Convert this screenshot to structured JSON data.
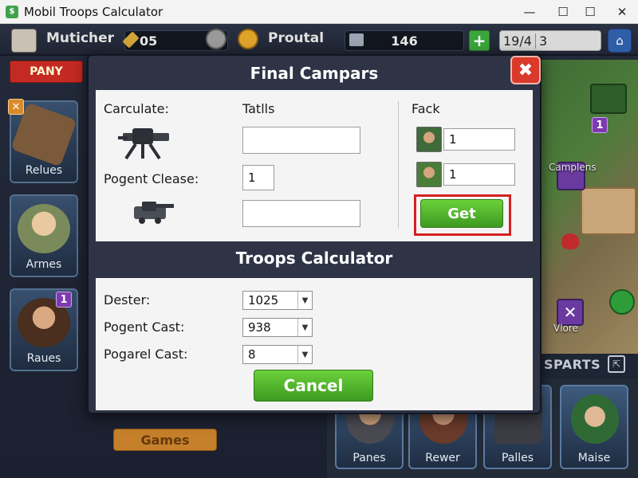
{
  "window": {
    "title": "Mobil Troops Calculator",
    "minimize": "—",
    "maximize": "☐",
    "close": "✕"
  },
  "topbar": {
    "player_name": "Muticher",
    "gems": "05",
    "currency_label": "Proutal",
    "resource_value": "146",
    "plus": "+",
    "progress_text": "19/4",
    "progress_extra": "3"
  },
  "sidebar": {
    "pany_label": "PANY",
    "cards": [
      {
        "label": "Relues"
      },
      {
        "label": "Armes"
      },
      {
        "label": "Raues",
        "badge": "1"
      }
    ]
  },
  "map": {
    "labels": [
      "Camplens",
      "Vlore"
    ],
    "badge": "1",
    "sparts_label": "SPARTS"
  },
  "bottom_cards": [
    {
      "label": "Panes"
    },
    {
      "label": "Rewer"
    },
    {
      "label": "Palles"
    },
    {
      "label": "Maise"
    }
  ],
  "games_peek": "Games",
  "dialog": {
    "title": "Final Campars",
    "close_symbol": "✖",
    "section1": {
      "calculate_label": "Carculate:",
      "details_header": "Tatlls",
      "pogent_clease_label": "Pogent Clease:",
      "field1_value": "",
      "field2_value": "1",
      "field3_value": "",
      "fack_header": "Fack",
      "fack1_value": "1",
      "fack2_value": "1",
      "get_label": "Get"
    },
    "section2": {
      "title": "Troops Calculator",
      "rows": [
        {
          "label": "Dester:",
          "value": "1025"
        },
        {
          "label": "Pogent Cast:",
          "value": "938"
        },
        {
          "label": "Pogarel Cast:",
          "value": "8"
        }
      ],
      "cancel_label": "Cancel"
    }
  },
  "colors": {
    "accent_green": "#4fb82c",
    "close_red": "#d93a2b",
    "highlight_frame": "#d42020",
    "badge_purple": "#7d3bb0"
  }
}
